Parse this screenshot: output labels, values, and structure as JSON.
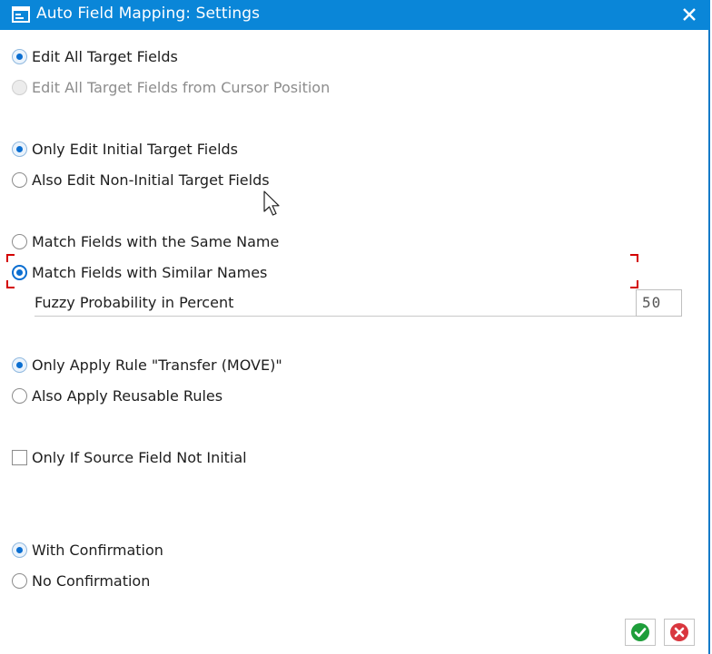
{
  "window": {
    "title": "Auto Field Mapping: Settings",
    "title_icon": "dialog-settings-icon",
    "close_icon": "close-icon"
  },
  "groups": [
    {
      "name": "edit-scope",
      "options": [
        {
          "label": "Edit All Target Fields",
          "selected": true,
          "enabled": true
        },
        {
          "label": "Edit All Target Fields from Cursor Position",
          "selected": false,
          "enabled": false
        }
      ]
    },
    {
      "name": "edit-target",
      "options": [
        {
          "label": "Only Edit Initial Target Fields",
          "selected": true,
          "enabled": true
        },
        {
          "label": "Also Edit Non-Initial Target Fields",
          "selected": false,
          "enabled": true
        }
      ]
    },
    {
      "name": "matching",
      "options": [
        {
          "label": "Match Fields with the Same Name",
          "selected": false,
          "enabled": true
        },
        {
          "label": "Match Fields with Similar Names",
          "selected": true,
          "enabled": true,
          "focused": true
        }
      ]
    },
    {
      "name": "rules",
      "options": [
        {
          "label": "Only Apply Rule \"Transfer (MOVE)\"",
          "selected": true,
          "enabled": true
        },
        {
          "label": "Also Apply Reusable Rules",
          "selected": false,
          "enabled": true
        }
      ]
    },
    {
      "name": "confirmation",
      "options": [
        {
          "label": "With Confirmation",
          "selected": true,
          "enabled": true
        },
        {
          "label": "No Confirmation",
          "selected": false,
          "enabled": true
        }
      ]
    }
  ],
  "fuzzy": {
    "label": "Fuzzy Probability in Percent",
    "value": "50"
  },
  "source_check": {
    "label": "Only If Source Field Not Initial",
    "checked": false
  },
  "buttons": {
    "ok_icon": "check-icon",
    "cancel_icon": "cancel-icon"
  },
  "colors": {
    "titlebar": "#0a86d8",
    "radio_selected": "#0a6ed1",
    "focus_marker": "#d40000",
    "ok_green": "#1e9e3a",
    "cancel_red": "#d9363e"
  }
}
